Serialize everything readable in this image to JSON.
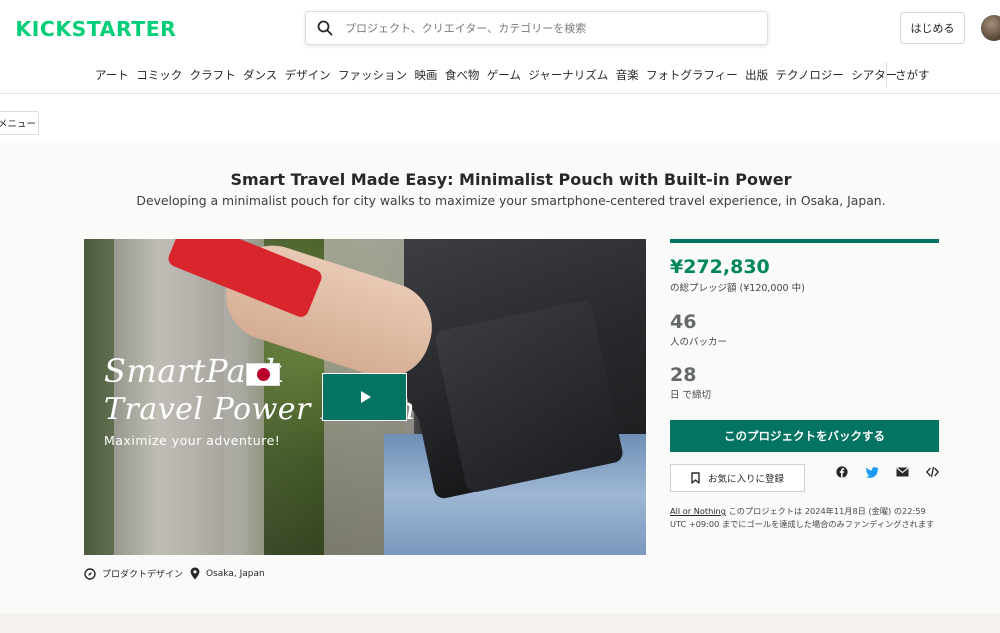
{
  "header": {
    "logo": "KICKSTARTER",
    "search_placeholder": "プロジェクト、クリエイター、カテゴリーを検索",
    "start_button": "はじめる"
  },
  "nav": {
    "items": [
      "アート",
      "コミック",
      "クラフト",
      "ダンス",
      "デザイン",
      "ファッション",
      "映画",
      "食べ物",
      "ゲーム",
      "ジャーナリズム",
      "音楽",
      "フォトグラフィー",
      "出版",
      "テクノロジー",
      "シアター"
    ],
    "search": "さがす"
  },
  "menu_button": "メニュー",
  "project": {
    "title": "Smart Travel Made Easy: Minimalist Pouch with Built-in Power",
    "subtitle": "Developing a minimalist pouch for city walks to maximize your smartphone-centered travel experience, in Osaka, Japan.",
    "video_overlay": {
      "line1": "SmartPack",
      "line2": "Travel Power Pouch",
      "line3": "Maximize your adventure!"
    },
    "category": "プロダクトデザイン",
    "location": "Osaka, Japan"
  },
  "stats": {
    "progress_fraction": 1.0,
    "pledged": "¥272,830",
    "pledged_sub": "の総プレッジ額 (¥120,000 中)",
    "backers": "46",
    "backers_sub": "人のバッカー",
    "days": "28",
    "days_sub": "日 で締切",
    "back_button": "このプロジェクトをバックする",
    "favorite_button": "お気に入りに登録",
    "aon_link": "All or Nothing",
    "aon_text": " このプロジェクトは 2024年11月8日 (金曜) の22:59 UTC +09:00 までにゴールを達成した場合のみファンディングされます"
  },
  "colors": {
    "brand_green": "#05ce78",
    "accent_green": "#037362",
    "pledged_green": "#028858"
  }
}
